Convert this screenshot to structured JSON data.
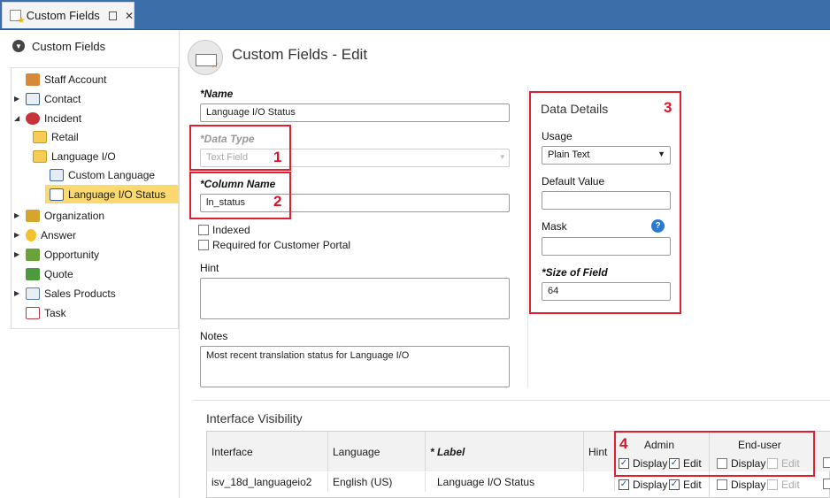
{
  "tab": {
    "label": "Custom Fields",
    "close": "✕"
  },
  "nav": {
    "header": "Custom Fields",
    "items": [
      {
        "label": "Staff Account"
      },
      {
        "label": "Contact"
      },
      {
        "label": "Incident"
      },
      {
        "label": "Retail"
      },
      {
        "label": "Language I/O"
      },
      {
        "label": "Custom Language"
      },
      {
        "label": "Language I/O Status"
      },
      {
        "label": "Organization"
      },
      {
        "label": "Answer"
      },
      {
        "label": "Opportunity"
      },
      {
        "label": "Quote"
      },
      {
        "label": "Sales Products"
      },
      {
        "label": "Task"
      }
    ]
  },
  "page": {
    "title": "Custom Fields - Edit"
  },
  "form": {
    "name_label": "*Name",
    "name_value": "Language I/O Status",
    "datatype_label": "*Data Type",
    "datatype_value": "Text Field",
    "colname_label": "*Column Name",
    "colname_value": "ln_status",
    "indexed_label": "Indexed",
    "required_label": "Required for Customer Portal",
    "hint_label": "Hint",
    "notes_label": "Notes",
    "notes_value": "Most recent translation status for Language I/O"
  },
  "details": {
    "title": "Data Details",
    "usage_label": "Usage",
    "usage_value": "Plain Text",
    "default_label": "Default Value",
    "mask_label": "Mask",
    "size_label": "*Size of Field",
    "size_value": "64"
  },
  "annotations": [
    "1",
    "2",
    "3",
    "4"
  ],
  "visibility": {
    "title": "Interface Visibility",
    "headers": {
      "interface": "Interface",
      "language": "Language",
      "label": "* Label",
      "hint": "Hint"
    },
    "admin": "Admin",
    "enduser": "End-user",
    "display": "Display",
    "edit": "Edit",
    "row": {
      "interface": "isv_18d_languageio2",
      "language": "English (US)",
      "label": "Language I/O Status"
    }
  },
  "colors": {
    "annotation": "#e0202e",
    "tabstrip": "#3c6fa9",
    "selected": "#fcd96e"
  }
}
